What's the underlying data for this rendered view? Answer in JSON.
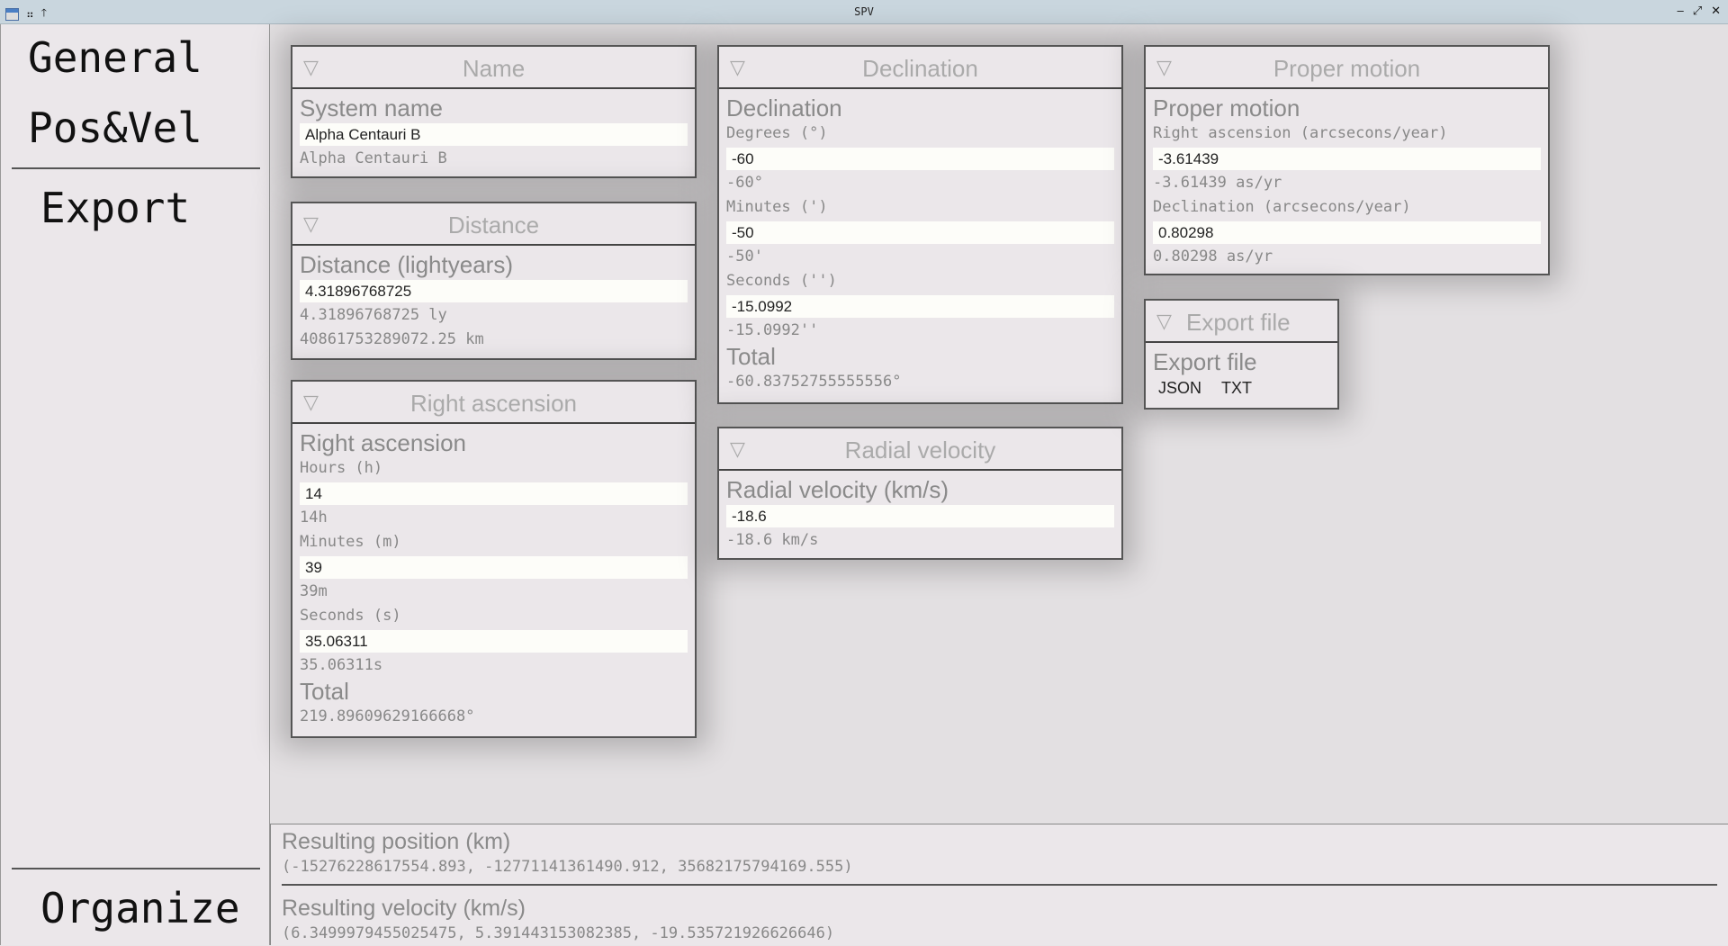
{
  "window": {
    "title": "SPV"
  },
  "sidebar": {
    "items": [
      {
        "label": "General"
      },
      {
        "label": "Pos&Vel"
      },
      {
        "label": "Export"
      },
      {
        "label": "Organize"
      }
    ]
  },
  "panels": {
    "name": {
      "title": "Name",
      "label": "System name",
      "value": "Alpha Centauri B",
      "display": "Alpha Centauri B"
    },
    "distance": {
      "title": "Distance",
      "label": "Distance (lightyears)",
      "value": "4.31896768725",
      "display_ly": "4.31896768725 ly",
      "display_km": "40861753289072.25 km"
    },
    "ra": {
      "title": "Right ascension",
      "label": "Right ascension",
      "hours_label": "Hours (h)",
      "hours": "14",
      "hours_display": "14h",
      "minutes_label": "Minutes (m)",
      "minutes": "39",
      "minutes_display": "39m",
      "seconds_label": "Seconds (s)",
      "seconds": "35.06311",
      "seconds_display": "35.06311s",
      "total_label": "Total",
      "total": "219.89609629166668°"
    },
    "dec": {
      "title": "Declination",
      "label": "Declination",
      "degrees_label": "Degrees (°)",
      "degrees": "-60",
      "degrees_display": "-60°",
      "minutes_label": "Minutes (')",
      "minutes": "-50",
      "minutes_display": "-50'",
      "seconds_label": "Seconds ('')",
      "seconds": "-15.0992",
      "seconds_display": "-15.0992''",
      "total_label": "Total",
      "total": "-60.83752755555556°"
    },
    "rv": {
      "title": "Radial velocity",
      "label": "Radial velocity (km/s)",
      "value": "-18.6",
      "display": "-18.6 km/s"
    },
    "pm": {
      "title": "Proper motion",
      "label": "Proper motion",
      "ra_label": "Right ascension (arcsecons/year)",
      "ra": "-3.61439",
      "ra_display": "-3.61439 as/yr",
      "dec_label": "Declination (arcsecons/year)",
      "dec": "0.80298",
      "dec_display": "0.80298 as/yr"
    },
    "export": {
      "title": "Export file",
      "label": "Export file",
      "options": [
        "JSON",
        "TXT"
      ]
    }
  },
  "results": {
    "position_label": "Resulting position (km)",
    "position": "(-15276228617554.893, -12771141361490.912, 35682175794169.555)",
    "velocity_label": "Resulting velocity (km/s)",
    "velocity": "(6.3499979455025475, 5.391443153082385, -19.535721926626646)"
  }
}
